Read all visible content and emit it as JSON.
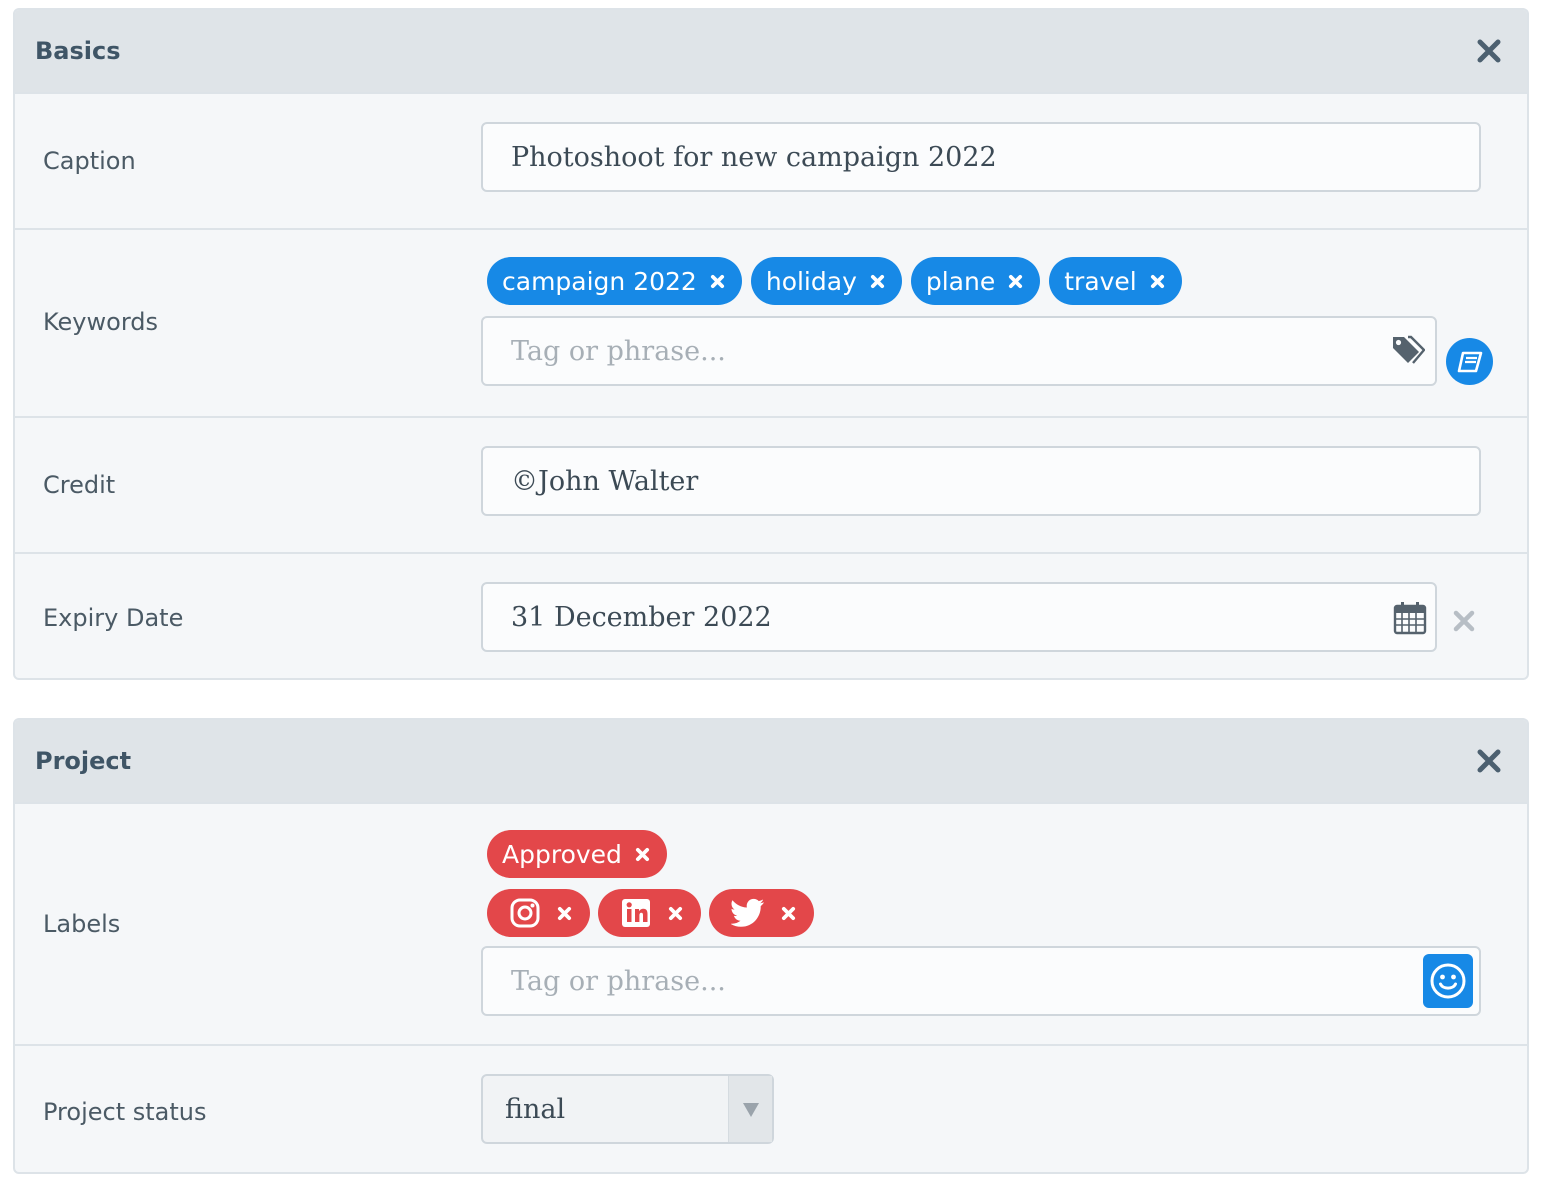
{
  "colors": {
    "tag_blue": "#1789e6",
    "tag_red": "#e3474a",
    "header_bg": "#dfe4e8"
  },
  "basics": {
    "title": "Basics",
    "close_icon": "close-icon",
    "caption": {
      "label": "Caption",
      "value": "Photoshoot for new campaign 2022"
    },
    "keywords": {
      "label": "Keywords",
      "tags": [
        "campaign 2022",
        "holiday",
        "plane",
        "travel"
      ],
      "placeholder": "Tag or phrase...",
      "input_icon": "tags-icon",
      "button_icon": "book-icon"
    },
    "credit": {
      "label": "Credit",
      "value": "©John Walter"
    },
    "expiry": {
      "label": "Expiry Date",
      "value": "31 December 2022",
      "input_icon": "calendar-icon",
      "clear_icon": "clear-icon"
    }
  },
  "project": {
    "title": "Project",
    "close_icon": "close-icon",
    "labels": {
      "label": "Labels",
      "text_tags": [
        "Approved"
      ],
      "icon_tags": [
        "instagram-icon",
        "linkedin-icon",
        "twitter-icon"
      ],
      "placeholder": "Tag or phrase...",
      "button_icon": "smiley-icon"
    },
    "status": {
      "label": "Project status",
      "value": "final",
      "arrow_icon": "dropdown-arrow-icon"
    }
  }
}
